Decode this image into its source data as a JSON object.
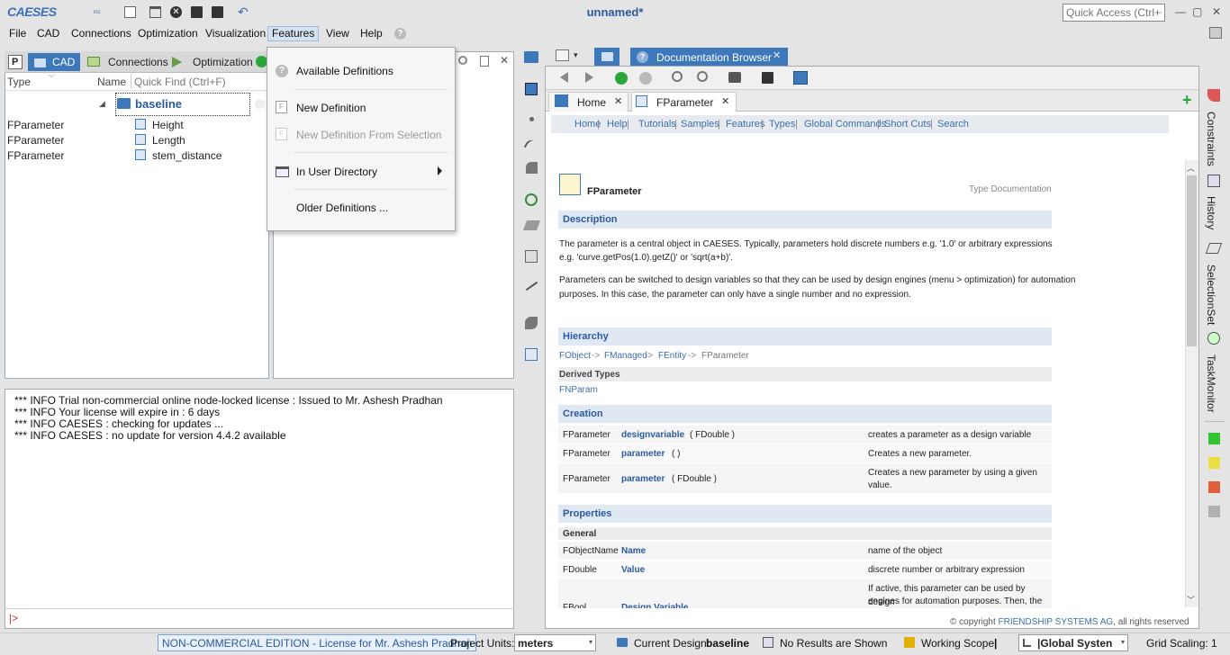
{
  "app": {
    "logo": "CAESES",
    "logo_sub": "inc",
    "window_title": "unnamed*",
    "quick_access_placeholder": "Quick Access (Ctrl+Q)"
  },
  "menubar": {
    "items": [
      "File",
      "CAD",
      "Connections",
      "Optimization",
      "Visualization",
      "Features",
      "View",
      "Help"
    ],
    "active": "Features"
  },
  "features_menu": {
    "items": [
      {
        "label": "Available Definitions",
        "icon": "help-icon",
        "disabled": false
      },
      {
        "label": "New Definition",
        "icon": "definition-icon",
        "disabled": false
      },
      {
        "label": "New Definition From Selection",
        "icon": "definition-icon",
        "disabled": true
      },
      {
        "label": "In User Directory",
        "icon": "folder-icon",
        "disabled": false,
        "submenu": true
      },
      {
        "label": "Older Definitions ...",
        "icon": "",
        "disabled": false
      }
    ]
  },
  "tree_panel": {
    "tabs": [
      {
        "label": "P"
      },
      {
        "label": "CAD",
        "selected": true
      },
      {
        "label": "Connections"
      },
      {
        "label": "Optimization"
      }
    ],
    "columns": {
      "type": "Type",
      "name": "Name"
    },
    "quick_find_placeholder": "Quick Find (Ctrl+F)",
    "root": "baseline",
    "rows": [
      {
        "type": "FParameter",
        "name": "Height"
      },
      {
        "type": "FParameter",
        "name": "Length"
      },
      {
        "type": "FParameter",
        "name": "stem_distance"
      }
    ]
  },
  "console": {
    "lines": [
      "*** INFO Trial non-commercial online node-locked license : Issued to Mr. Ashesh Pradhan",
      "*** INFO Your license will expire in : 6 days",
      "*** INFO CAESES : checking for updates ...",
      "*** INFO CAESES : no update for version 4.4.2 available"
    ],
    "prompt": "|>"
  },
  "doc_browser": {
    "tab_title": "Documentation Browser",
    "tabs": [
      {
        "label": "Home"
      },
      {
        "label": "FParameter",
        "selected": true
      }
    ],
    "nav_links": [
      "Home",
      "Help",
      "Tutorials",
      "Samples",
      "Features",
      "Types",
      "Global Commands",
      "Short Cuts",
      "Search"
    ],
    "page_title": "FParameter",
    "page_type": "Type Documentation",
    "sections": {
      "description": "Description",
      "desc_p1": "The parameter is a central object in CAESES. Typically, parameters hold discrete numbers e.g. '1.0' or arbitrary expressions",
      "desc_p1b": "e.g. 'curve.getPos(1.0).getZ()' or 'sqrt(a+b)'.",
      "desc_p2": "Parameters can be switched to design variables so that they can be used by design engines (menu > optimization) for automation",
      "desc_p2b": "purposes. In this case, the parameter can only have a single number and no expression.",
      "hierarchy": "Hierarchy",
      "hierarchy_chain": [
        "FObject",
        "FManaged",
        "FEntity",
        "FParameter"
      ],
      "derived_types": "Derived Types",
      "derived": "FNParam",
      "creation": "Creation",
      "properties": "Properties",
      "general": "General"
    },
    "creation_rows": [
      {
        "type": "FParameter",
        "name": "designvariable",
        "args": "( FDouble )",
        "desc": "creates a parameter as a design variable"
      },
      {
        "type": "FParameter",
        "name": "parameter",
        "args": "( )",
        "desc": "Creates a new parameter."
      },
      {
        "type": "FParameter",
        "name": "parameter",
        "args": "( FDouble )",
        "desc": "Creates a new parameter by using a given",
        "desc2": "value."
      }
    ],
    "property_rows": [
      {
        "type": "FObjectName",
        "name": "Name",
        "desc": "name of the object"
      },
      {
        "type": "FDouble",
        "name": "Value",
        "desc": "discrete number or arbitrary expression"
      },
      {
        "type": "FBool",
        "name": "Design Variable",
        "desc": "If active, this parameter can be used by design",
        "desc2": "engines for automation purposes. Then, the"
      }
    ],
    "copyright_prefix": "© copyright",
    "copyright_company": "FRIENDSHIP SYSTEMS AG",
    "copyright_suffix": ", all rights reserved"
  },
  "right_rail": {
    "tabs": [
      "Constraints",
      "History",
      "SelectionSet",
      "TaskMonitor"
    ],
    "status_colors": [
      "#33c433",
      "#e8e040",
      "#e06040",
      "#b0b0b0"
    ]
  },
  "statusbar": {
    "edition": "NON-COMMERCIAL EDITION - License for Mr. Ashesh Pradhan",
    "units_label": "Project Units:",
    "units_value": "meters",
    "current_design_label": "Current Design:",
    "current_design_value": "baseline",
    "results": "No Results are Shown",
    "working_scope_label": "Working Scope:",
    "working_scope_value": "|",
    "global_system": "|Global Systen",
    "grid_scaling": "Grid Scaling: 1"
  },
  "colors": {
    "accent": "#3d78bb",
    "link": "#3d6fae",
    "section_bg": "#dfe8f3"
  }
}
